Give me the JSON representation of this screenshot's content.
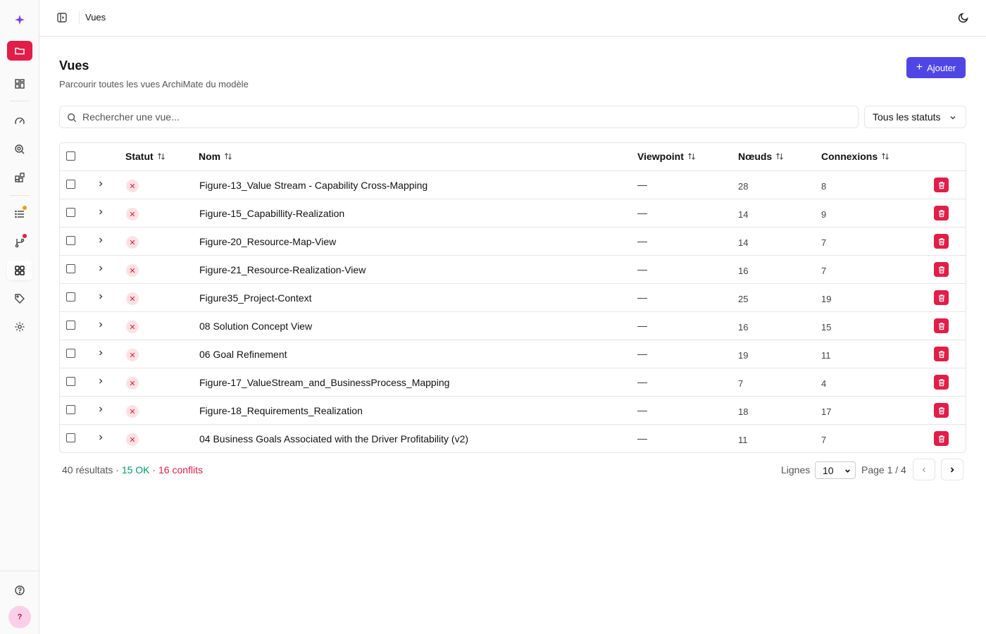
{
  "topbar": {
    "title": "Vues"
  },
  "header": {
    "title": "Vues",
    "subtitle": "Parcourir toutes les vues ArchiMate du modèle",
    "add_label": "Ajouter"
  },
  "search": {
    "placeholder": "Rechercher une vue..."
  },
  "status_filter": {
    "selected": "Tous les statuts"
  },
  "columns": {
    "status": "Statut",
    "name": "Nom",
    "viewpoint": "Viewpoint",
    "nodes": "Nœuds",
    "connections": "Connexions"
  },
  "rows": [
    {
      "name": "Figure-13_Value Stream - Capability Cross-Mapping",
      "viewpoint": "—",
      "nodes": "28",
      "connections": "8"
    },
    {
      "name": "Figure-15_Capabillity-Realization",
      "viewpoint": "—",
      "nodes": "14",
      "connections": "9"
    },
    {
      "name": "Figure-20_Resource-Map-View",
      "viewpoint": "—",
      "nodes": "14",
      "connections": "7"
    },
    {
      "name": "Figure-21_Resource-Realization-View",
      "viewpoint": "—",
      "nodes": "16",
      "connections": "7"
    },
    {
      "name": "Figure35_Project-Context",
      "viewpoint": "—",
      "nodes": "25",
      "connections": "19"
    },
    {
      "name": "08 Solution Concept View",
      "viewpoint": "—",
      "nodes": "16",
      "connections": "15"
    },
    {
      "name": "06 Goal Refinement",
      "viewpoint": "—",
      "nodes": "19",
      "connections": "11"
    },
    {
      "name": "Figure-17_ValueStream_and_BusinessProcess_Mapping",
      "viewpoint": "—",
      "nodes": "7",
      "connections": "4"
    },
    {
      "name": "Figure-18_Requirements_Realization",
      "viewpoint": "—",
      "nodes": "18",
      "connections": "17"
    },
    {
      "name": "04 Business Goals Associated with the Driver Profitability (v2)",
      "viewpoint": "—",
      "nodes": "11",
      "connections": "7"
    }
  ],
  "footer": {
    "results": "40 résultats",
    "sep": " · ",
    "ok": "15 OK",
    "conflicts": "16 conflits",
    "lines_label": "Lignes",
    "lines_value": "10",
    "page": "Page 1 / 4"
  },
  "sidebar": {
    "avatar": "?"
  },
  "colors": {
    "accent": "#4f46e5",
    "danger": "#e11d48",
    "ok": "#059669",
    "notification_orange": "#f59e0b",
    "notification_red": "#e11d48"
  },
  "icons": {
    "sidebar": [
      "sparkle-icon",
      "folder-icon",
      "layout-grid-icon",
      "gauge-icon",
      "zoom-search-icon",
      "blocks-icon",
      "list-icon",
      "git-branch-icon",
      "views-grid-icon",
      "tag-icon",
      "settings-icon",
      "help-circle-icon"
    ],
    "topbar": [
      "sidebar-toggle-icon",
      "moon-icon"
    ],
    "row": [
      "chevron-right-icon",
      "x-icon",
      "trash-icon"
    ]
  }
}
